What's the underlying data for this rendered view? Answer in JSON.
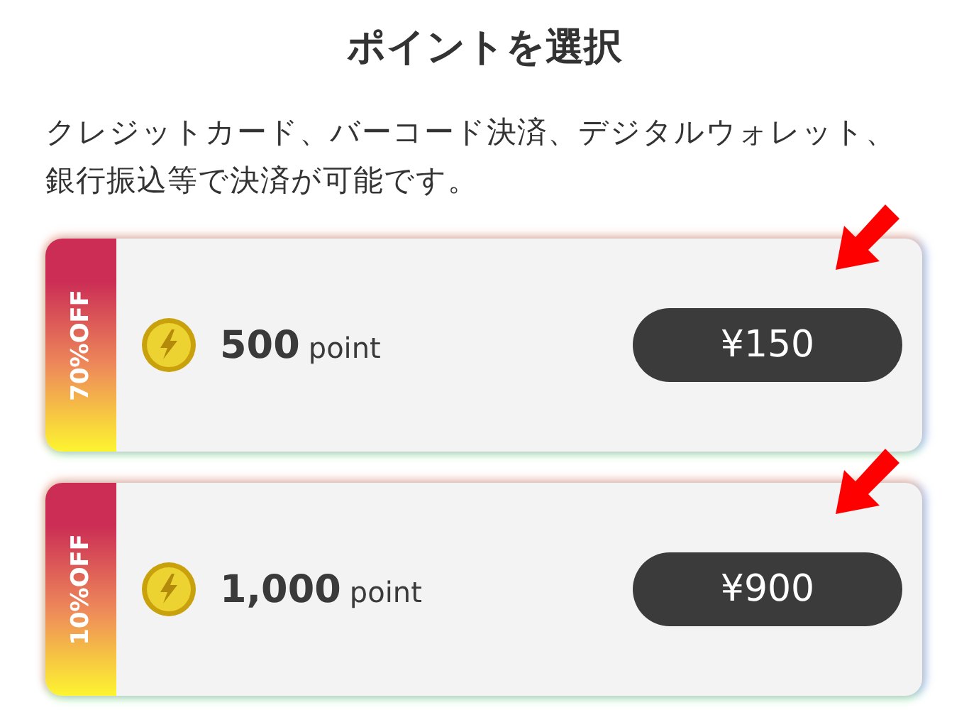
{
  "title": "ポイントを選択",
  "description": "クレジットカード、バーコード決済、デジタルウォレット、銀行振込等で決済が可能です。",
  "plans": [
    {
      "discount": "70%OFF",
      "amount": "500",
      "unit": "point",
      "price": "¥150"
    },
    {
      "discount": "10%OFF",
      "amount": "1,000",
      "unit": "point",
      "price": "¥900"
    }
  ]
}
